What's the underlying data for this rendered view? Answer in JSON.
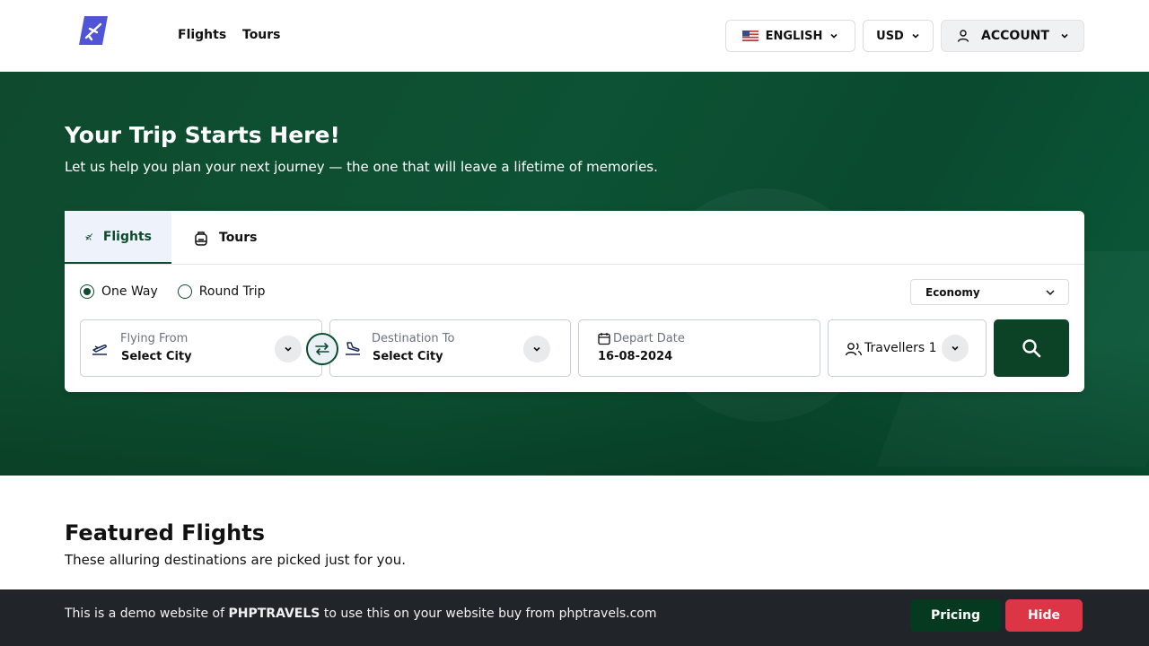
{
  "header": {
    "nav": [
      "Flights",
      "Tours"
    ],
    "language": "ENGLISH",
    "currency": "USD",
    "account": "ACCOUNT"
  },
  "hero": {
    "title": "Your Trip Starts Here!",
    "subtitle": "Let us help you plan your next journey — the one that will leave a lifetime of memories."
  },
  "search": {
    "tabs": [
      "Flights",
      "Tours"
    ],
    "trip_types": [
      "One Way",
      "Round Trip"
    ],
    "selected_trip_type": "One Way",
    "cabin_class": "Economy",
    "from": {
      "label": "Flying From",
      "value": "Select City"
    },
    "to": {
      "label": "Destination To",
      "value": "Select City"
    },
    "depart": {
      "label": "Depart Date",
      "value": "16-08-2024"
    },
    "travellers": {
      "label": "Travellers",
      "count": "1"
    }
  },
  "featured": {
    "title": "Featured Flights",
    "subtitle": "These alluring destinations are picked just for you."
  },
  "demo_bar": {
    "text_before": "This is a demo website of",
    "brand": "PHPTRAVELS",
    "text_after": "to use this on your website buy from phptravels.com",
    "pricing_label": "Pricing",
    "hide_label": "Hide"
  },
  "colors": {
    "primary_green": "#0c4b2c",
    "hero_green": "#0d5234",
    "logo_blue": "#4f55d6",
    "hide_red": "#dc3545",
    "demo_bar_bg": "#212529"
  }
}
